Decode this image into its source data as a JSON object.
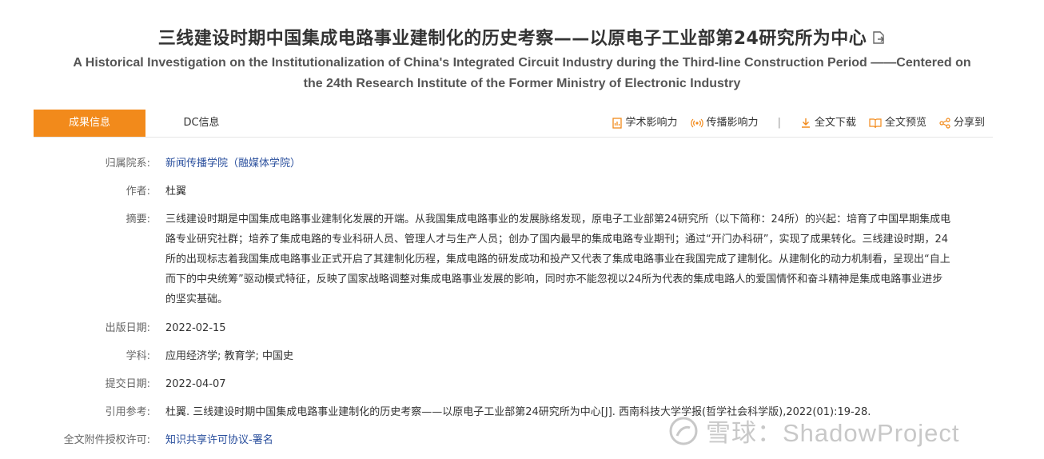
{
  "title_cn": "三线建设时期中国集成电路事业建制化的历史考察——以原电子工业部第24研究所为中心",
  "title_en": "A Historical Investigation on the Institutionalization of China's Integrated Circuit Industry during the Third-line Construction Period ——Centered on the 24th Research Institute of the Former Ministry of Electronic Industry",
  "tabs": [
    {
      "label": "成果信息",
      "active": true
    },
    {
      "label": "DC信息",
      "active": false
    }
  ],
  "actions": {
    "academic": "学术影响力",
    "spread": "传播影响力",
    "separator": "|",
    "download": "全文下载",
    "preview": "全文预览",
    "share": "分享到"
  },
  "fields": {
    "college": {
      "label": "归属院系:",
      "value": "新闻传播学院（融媒体学院）"
    },
    "author": {
      "label": "作者:",
      "value": "杜翼"
    },
    "abstract": {
      "label": "摘要:",
      "value": "三线建设时期是中国集成电路事业建制化发展的开端。从我国集成电路事业的发展脉络发现，原电子工业部第24研究所（以下简称：24所）的兴起：培育了中国早期集成电路专业研究社群；培养了集成电路的专业科研人员、管理人才与生产人员；创办了国内最早的集成电路专业期刊；通过“开门办科研”，实现了成果转化。三线建设时期，24所的出现标志着我国集成电路事业正式开启了其建制化历程，集成电路的研发成功和投产又代表了集成电路事业在我国完成了建制化。从建制化的动力机制看，呈现出“自上而下的中央统筹”驱动模式特征，反映了国家战略调整对集成电路事业发展的影响，同时亦不能忽视以24所为代表的集成电路人的爱国情怀和奋斗精神是集成电路事业进步的坚实基础。"
    },
    "pub_date": {
      "label": "出版日期:",
      "value": "2022-02-15"
    },
    "subject": {
      "label": "学科:",
      "value": "应用经济学; 教育学; 中国史"
    },
    "submit_date": {
      "label": "提交日期:",
      "value": "2022-04-07"
    },
    "citation": {
      "label": "引用参考:",
      "value": "杜翼. 三线建设时期中国集成电路事业建制化的历史考察——以原电子工业部第24研究所为中心[J]. 西南科技大学学报(哲学社会科学版),2022(01):19-28."
    },
    "license": {
      "label": "全文附件授权许可:",
      "value": "知识共享许可协议-署名"
    }
  },
  "watermark": "雪球：ShadowProject",
  "colors": {
    "accent": "#f28a1b",
    "link": "#2a4f9d"
  }
}
